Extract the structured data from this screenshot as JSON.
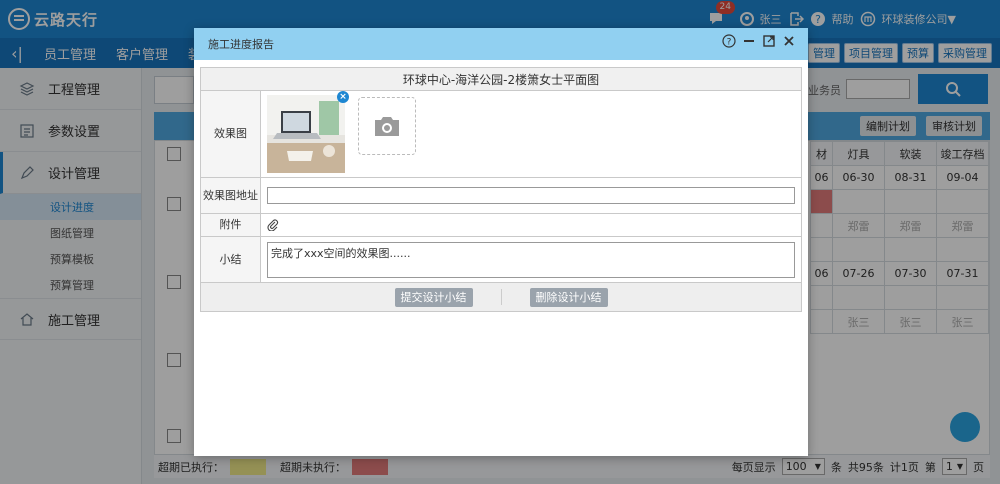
{
  "header": {
    "brand": "云路天行",
    "notification_count": "24",
    "username": "张三",
    "help_label": "帮助",
    "company": "环球装修公司"
  },
  "nav": {
    "back_icon": "chevron-left-icon",
    "items": [
      "员工管理",
      "客户管理",
      "装"
    ],
    "right_items": [
      "管理",
      "项目管理",
      "预算",
      "采购管理"
    ]
  },
  "sidebar": {
    "groups": [
      {
        "label": "工程管理",
        "icon": "layers-icon"
      },
      {
        "label": "参数设置",
        "icon": "list-icon"
      },
      {
        "label": "设计管理",
        "icon": "pen-icon"
      }
    ],
    "subs": [
      "设计进度",
      "图纸管理",
      "预算模板",
      "预算管理"
    ],
    "last_group": {
      "label": "施工管理",
      "icon": "home-icon"
    }
  },
  "main": {
    "search_label": "业务员",
    "edit_plan": "编制计划",
    "review_plan": "审核计划",
    "columns": [
      "材",
      "灯具",
      "软装",
      "竣工存档"
    ],
    "rows": [
      [
        "06",
        "06-30",
        "08-31",
        "09-04"
      ],
      [
        "",
        "郑雷",
        "郑雷",
        "郑雷"
      ],
      [
        "06",
        "07-26",
        "07-30",
        "07-31"
      ],
      [
        "",
        "张三",
        "张三",
        "张三"
      ]
    ],
    "footer": {
      "overdue_done": "超期已执行：",
      "overdue_pending": "超期未执行：",
      "per_page_label": "每页显示",
      "per_page_value": "100",
      "per_page_unit": "条",
      "total": "共95条",
      "pages": "计1页",
      "page_prefix": "第",
      "page_value": "1",
      "page_suffix": "页"
    },
    "colors": {
      "yellow": "#f0ea8a",
      "red": "#e37b7b"
    }
  },
  "modal": {
    "title": "施工进度报告",
    "form_title": "环球中心-海洋公园-2楼箫女士平面图",
    "labels": {
      "effect_image": "效果图",
      "effect_url": "效果图地址",
      "attachment": "附件",
      "summary": "小结"
    },
    "summary_text": "完成了xxx空间的效果图......",
    "submit_label": "提交设计小结",
    "delete_label": "删除设计小结"
  }
}
